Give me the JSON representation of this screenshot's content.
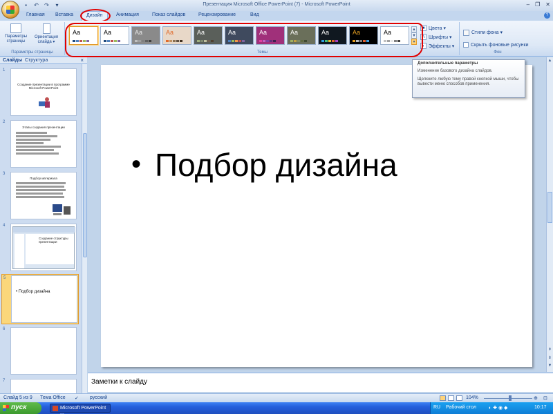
{
  "window": {
    "title": "Презентация Microsoft Office PowerPoint (7) - Microsoft PowerPoint",
    "controls": [
      "–",
      "❐",
      "✕"
    ]
  },
  "tabs": [
    "Главная",
    "Вставка",
    "Дизайн",
    "Анимация",
    "Показ слайдов",
    "Рецензирование",
    "Вид"
  ],
  "active_tab": "Дизайн",
  "ribbon": {
    "page_setup": {
      "btn_setup": "Параметры страницы",
      "btn_orientation": "Ориентация слайда ▾",
      "group_label": "Параметры страницы"
    },
    "themes": {
      "group_label": "Темы",
      "aa_label": "Aa",
      "gallery": [
        {
          "bg": "#ffffff",
          "fg": "#000000",
          "sw": [
            "#1f497d",
            "#4f81bd",
            "#c0504d",
            "#9bbb59",
            "#8064a2"
          ],
          "selected": true
        },
        {
          "bg": "#ffffff",
          "fg": "#000000",
          "sw": [
            "#1f497d",
            "#4f81bd",
            "#c0504d",
            "#9bbb59",
            "#8064a2"
          ],
          "selected": false
        },
        {
          "bg": "#8a8a8a",
          "fg": "#e8e8e8",
          "sw": [
            "#c0c0c0",
            "#a0a0a0",
            "#808080",
            "#606060",
            "#404040"
          ],
          "selected": false
        },
        {
          "bg": "#e8d8c8",
          "fg": "#e06a2a",
          "sw": [
            "#e06a2a",
            "#c09060",
            "#8a7050",
            "#605040",
            "#403020"
          ],
          "selected": false
        },
        {
          "bg": "#5a5f5a",
          "fg": "#ffffff",
          "sw": [
            "#a0b080",
            "#808a70",
            "#c0c0a0",
            "#706050",
            "#504030"
          ],
          "selected": false
        },
        {
          "bg": "#3f4a5e",
          "fg": "#ffffff",
          "sw": [
            "#4f81bd",
            "#9bbb59",
            "#f79646",
            "#c0504d",
            "#8064a2"
          ],
          "selected": false
        },
        {
          "bg": "#a0307a",
          "fg": "#ffffff",
          "sw": [
            "#e040a0",
            "#c060c0",
            "#8040a0",
            "#60307a",
            "#402050"
          ],
          "selected": false
        },
        {
          "bg": "#6a6f5a",
          "fg": "#ffffff",
          "sw": [
            "#a0b060",
            "#c0a040",
            "#808a60",
            "#606a40",
            "#404a30"
          ],
          "selected": false
        },
        {
          "bg": "#101820",
          "fg": "#ffffff",
          "sw": [
            "#30a0e0",
            "#40c080",
            "#e0c030",
            "#e06030",
            "#a040c0"
          ],
          "selected": false
        },
        {
          "bg": "#000000",
          "fg": "#e8a020",
          "sw": [
            "#e8a020",
            "#c0c0c0",
            "#808080",
            "#e06030",
            "#40a0e0"
          ],
          "selected": false
        },
        {
          "bg": "#ffffff",
          "fg": "#000000",
          "sw": [
            "#c0c0c0",
            "#a0a0a0",
            "#e8e8e8",
            "#808080",
            "#404040"
          ],
          "selected": false
        }
      ],
      "colors": "Цвета ▾",
      "fonts": "Шрифты ▾",
      "effects": "Эффекты ▾"
    },
    "background": {
      "styles": "Стили фона ▾",
      "hide_graphics": "Скрыть фоновые рисунки",
      "group_label": "Фон"
    }
  },
  "tooltip": {
    "title": "Дополнительные параметры",
    "line1": "Изменение базового дизайна слайдов.",
    "line2": "Щелкните любую тему правой кнопкой мыши, чтобы вывести меню способов применения."
  },
  "pane": {
    "tab_slides": "Слайды",
    "tab_outline": "Структура",
    "close": "×",
    "thumbs": [
      {
        "num": "1",
        "title": "Создание презентации  в программе  Microsoft PowerPoint"
      },
      {
        "num": "2",
        "title": "Этапы создания презентации"
      },
      {
        "num": "3",
        "title": "Подбор материала"
      },
      {
        "num": "4",
        "title": "Создание структуры презентации"
      },
      {
        "num": "5",
        "title": "Подбор дизайна"
      },
      {
        "num": "6",
        "title": ""
      },
      {
        "num": "7",
        "title": ""
      }
    ]
  },
  "slide": {
    "bullet": "•",
    "text": "Подбор дизайна"
  },
  "notes": "Заметки к слайду",
  "status": {
    "slide_info": "Слайд 5 из 9",
    "theme": "Тема Office",
    "language": "русский",
    "zoom": "104%"
  },
  "taskbar": {
    "start": "пуск",
    "task": "Microsoft PowerPoint ...",
    "tray_lang": "RU",
    "tray_label": "Рабочий стол",
    "clock": "10:17"
  }
}
